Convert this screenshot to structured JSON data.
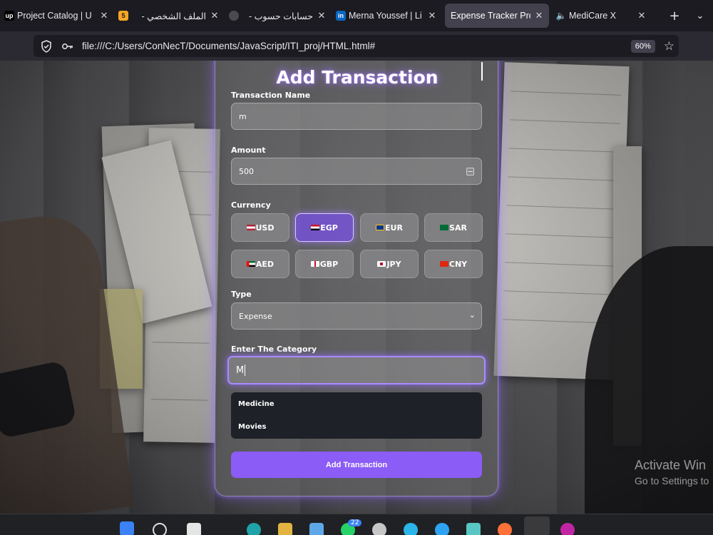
{
  "browser": {
    "tabs": [
      {
        "title": "Project Catalog | U",
        "icon": "upwork-icon",
        "color": "#000000"
      },
      {
        "title": "الملف الشخصي -",
        "icon": "badge-5-icon",
        "color": "#f5a623"
      },
      {
        "title": "حسابات حسوب -",
        "icon": "hsoub-icon",
        "color": "#555555"
      },
      {
        "title": "Merna Youssef | Li",
        "icon": "linkedin-icon",
        "color": "#0a66c2"
      },
      {
        "title": "Expense Tracker Pro",
        "icon": "",
        "color": "#42414d"
      },
      {
        "title": "MediCare X",
        "icon": "speaker-icon",
        "color": "#e8e8ea"
      }
    ],
    "url": "file:///C:/Users/ConNecT/Documents/JavaScript/ITI_proj/HTML.html#",
    "zoom": "60%"
  },
  "form": {
    "title": "Add Transaction",
    "name_label": "Transaction Name",
    "name_value": "m",
    "amount_label": "Amount",
    "amount_value": "500",
    "currency_label": "Currency",
    "currencies": [
      {
        "code": "USD",
        "flag": "us-flag-icon"
      },
      {
        "code": "EGP",
        "flag": "eg-flag-icon",
        "selected": true
      },
      {
        "code": "EUR",
        "flag": "eu-flag-icon"
      },
      {
        "code": "SAR",
        "flag": "sa-flag-icon"
      },
      {
        "code": "AED",
        "flag": "ae-flag-icon"
      },
      {
        "code": "GBP",
        "flag": "gb-flag-icon"
      },
      {
        "code": "JPY",
        "flag": "jp-flag-icon"
      },
      {
        "code": "CNY",
        "flag": "cn-flag-icon"
      }
    ],
    "type_label": "Type",
    "type_value": "Expense",
    "category_label": "Enter The Category",
    "category_value": "M",
    "suggestions": [
      "Medicine",
      "Movies"
    ],
    "submit_label": "Add Transaction",
    "accent": "#8b5cf6"
  },
  "watermark": {
    "line1": "Activate Win",
    "line2": "Go to Settings to"
  },
  "taskbar": {
    "badge": "22"
  }
}
